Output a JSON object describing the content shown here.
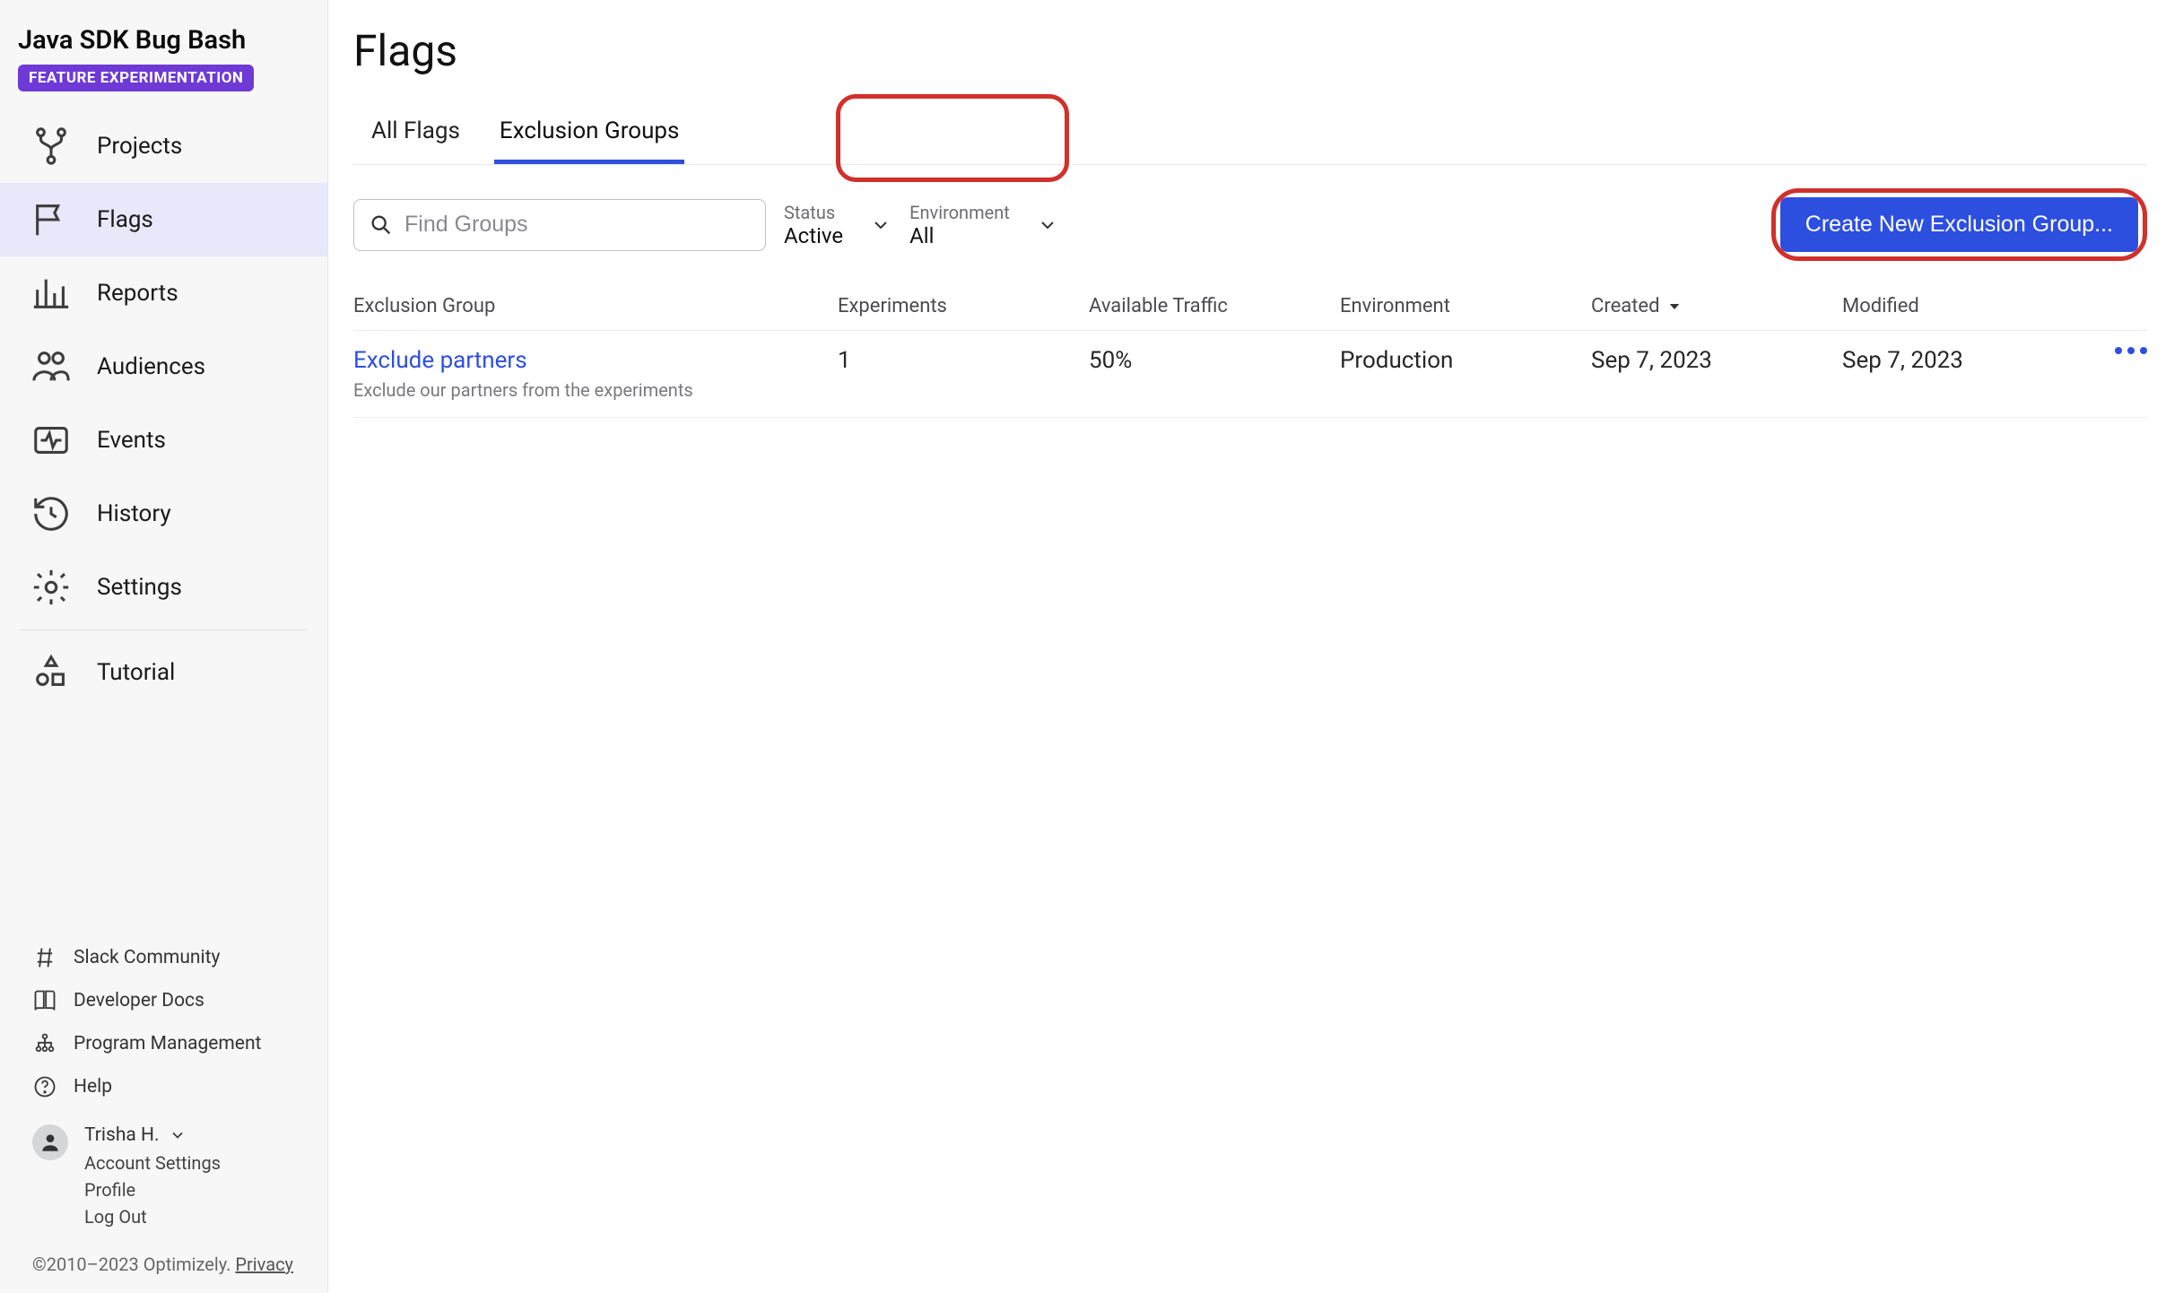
{
  "sidebar": {
    "title": "Java SDK Bug Bash",
    "badge": "FEATURE EXPERIMENTATION",
    "items": [
      {
        "id": "projects",
        "label": "Projects",
        "icon": "branch-icon"
      },
      {
        "id": "flags",
        "label": "Flags",
        "icon": "flag-icon"
      },
      {
        "id": "reports",
        "label": "Reports",
        "icon": "chart-icon"
      },
      {
        "id": "audiences",
        "label": "Audiences",
        "icon": "people-icon"
      },
      {
        "id": "events",
        "label": "Events",
        "icon": "pulse-icon"
      },
      {
        "id": "history",
        "label": "History",
        "icon": "history-icon"
      },
      {
        "id": "settings",
        "label": "Settings",
        "icon": "gear-icon"
      },
      {
        "id": "tutorial",
        "label": "Tutorial",
        "icon": "shapes-icon"
      }
    ],
    "active_id": "flags",
    "bottom_links": [
      {
        "id": "slack",
        "label": "Slack Community",
        "icon": "hash-icon"
      },
      {
        "id": "docs",
        "label": "Developer Docs",
        "icon": "book-icon"
      },
      {
        "id": "pm",
        "label": "Program Management",
        "icon": "org-icon"
      },
      {
        "id": "help",
        "label": "Help",
        "icon": "question-icon"
      }
    ],
    "user": {
      "name": "Trisha H.",
      "links": [
        "Account Settings",
        "Profile",
        "Log Out"
      ]
    },
    "copyright_prefix": "©2010–2023 Optimizely. ",
    "copyright_link": "Privacy"
  },
  "page": {
    "title": "Flags",
    "tabs": [
      {
        "id": "all",
        "label": "All Flags"
      },
      {
        "id": "exclusion",
        "label": "Exclusion Groups"
      }
    ],
    "active_tab": "exclusion",
    "search": {
      "placeholder": "Find Groups",
      "value": ""
    },
    "filters": {
      "status": {
        "label": "Status",
        "value": "Active"
      },
      "environment": {
        "label": "Environment",
        "value": "All"
      }
    },
    "create_button": "Create New Exclusion Group...",
    "columns": [
      "Exclusion Group",
      "Experiments",
      "Available Traffic",
      "Environment",
      "Created",
      "Modified"
    ],
    "sort_column": "Created",
    "rows": [
      {
        "name": "Exclude partners",
        "description": "Exclude our partners from the experiments",
        "experiments": "1",
        "available_traffic": "50%",
        "environment": "Production",
        "created": "Sep 7, 2023",
        "modified": "Sep 7, 2023"
      }
    ],
    "annotation_highlights": [
      "exclusion-tab",
      "create-button"
    ]
  }
}
